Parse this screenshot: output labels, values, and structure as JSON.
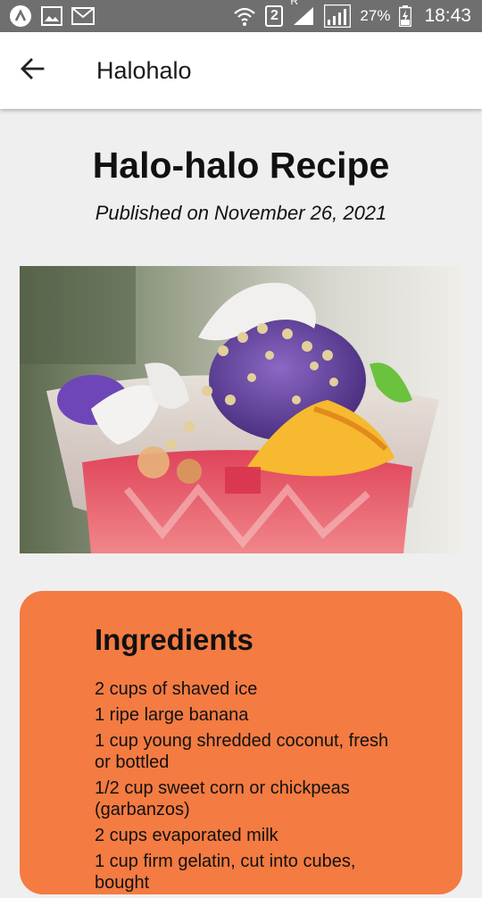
{
  "status_bar": {
    "icons_left": [
      "app-logo-icon",
      "image-icon",
      "mail-icon"
    ],
    "sim_label": "2",
    "roaming_label": "R",
    "battery": "27%",
    "time": "18:43"
  },
  "app_bar": {
    "title": "Halohalo",
    "back_icon": "arrow-left-icon"
  },
  "recipe": {
    "title": "Halo-halo Recipe",
    "published": "Published on November 26, 2021"
  },
  "ingredients": {
    "title": "Ingredients",
    "items": [
      "2 cups of shaved ice",
      "1 ripe large banana",
      "1 cup young shredded coconut, fresh or bottled",
      "1/2 cup sweet corn or chickpeas (garbanzos)",
      "2 cups evaporated milk",
      "1 cup firm gelatin, cut into cubes, bought"
    ]
  },
  "colors": {
    "status_bar": "#6f6f6f",
    "app_bar": "#ffffff",
    "background": "#efefef",
    "card": "#f47b42"
  }
}
